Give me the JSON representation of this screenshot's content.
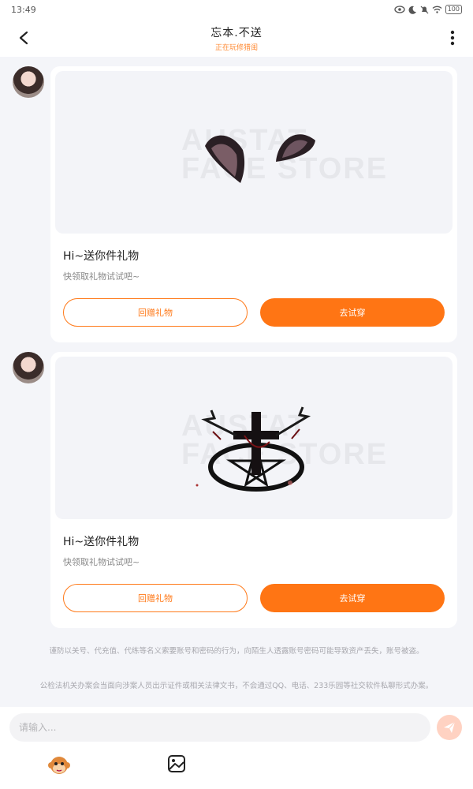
{
  "status_bar": {
    "time": "13:49",
    "battery": "100"
  },
  "header": {
    "title": "忘本.不送",
    "subtitle": "正在玩修猎闺"
  },
  "messages": [
    {
      "card_title": "Hi~送你件礼物",
      "card_desc": "快领取礼物试试吧~",
      "watermark": "AUSTAT\nFACE STORE",
      "gift_back_label": "回赠礼物",
      "try_label": "去试穿"
    },
    {
      "card_title": "Hi~送你件礼物",
      "card_desc": "快领取礼物试试吧~",
      "watermark": "AUSTAT\nFACE STORE",
      "gift_back_label": "回赠礼物",
      "try_label": "去试穿"
    }
  ],
  "notices": [
    "谨防以关号、代充值、代练等名义索要账号和密码的行为，向陌生人透露账号密码可能导致资产丢失，账号被盗。",
    "公检法机关办案会当面向涉案人员出示证件或相关法律文书，不会通过QQ、电话、233乐园等社交软件私聊形式办案。"
  ],
  "composer": {
    "placeholder": "请输入..."
  },
  "colors": {
    "accent": "#ff7514",
    "send_disabled": "#ffd2c2"
  }
}
